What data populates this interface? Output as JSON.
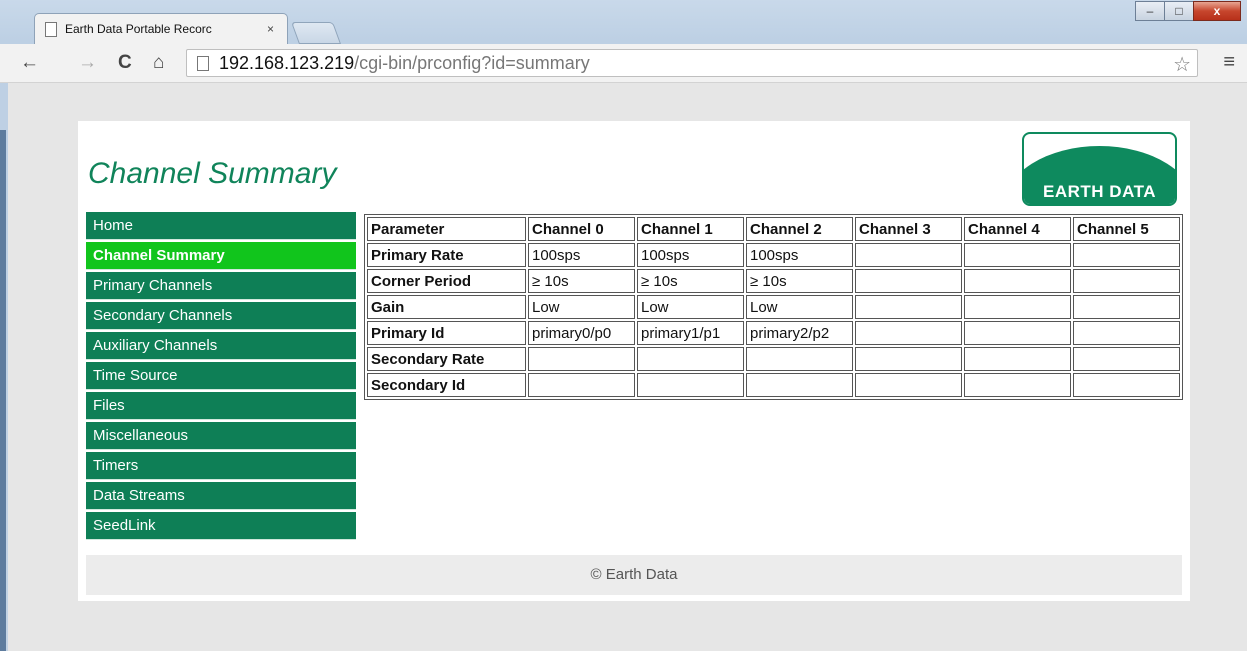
{
  "browser": {
    "tab_title": "Earth Data Portable Recorc",
    "tab_close": "×",
    "url_host": "192.168.123.219",
    "url_path": "/cgi-bin/prconfig?id=summary",
    "nav": {
      "back": "←",
      "forward": "→",
      "reload": "C",
      "home": "⌂"
    },
    "window_buttons": {
      "minimize": "–",
      "maximize": "□",
      "close": "x"
    }
  },
  "page": {
    "title": "Channel Summary",
    "logo_text": "EARTH DATA",
    "footer": "© Earth Data"
  },
  "sidebar": {
    "items": [
      {
        "label": "Home",
        "active": false
      },
      {
        "label": "Channel Summary",
        "active": true
      },
      {
        "label": "Primary Channels",
        "active": false
      },
      {
        "label": "Secondary Channels",
        "active": false
      },
      {
        "label": "Auxiliary Channels",
        "active": false
      },
      {
        "label": "Time Source",
        "active": false
      },
      {
        "label": "Files",
        "active": false
      },
      {
        "label": "Miscellaneous",
        "active": false
      },
      {
        "label": "Timers",
        "active": false
      },
      {
        "label": "Data Streams",
        "active": false
      },
      {
        "label": "SeedLink",
        "active": false
      }
    ]
  },
  "table": {
    "headers": [
      "Parameter",
      "Channel 0",
      "Channel 1",
      "Channel 2",
      "Channel 3",
      "Channel 4",
      "Channel 5"
    ],
    "rows": [
      [
        "Primary Rate",
        "100sps",
        "100sps",
        "100sps",
        "",
        "",
        ""
      ],
      [
        "Corner Period",
        "≥ 10s",
        "≥ 10s",
        "≥ 10s",
        "",
        "",
        ""
      ],
      [
        "Gain",
        "Low",
        "Low",
        "Low",
        "",
        "",
        ""
      ],
      [
        "Primary Id",
        "primary0/p0",
        "primary1/p1",
        "primary2/p2",
        "",
        "",
        ""
      ],
      [
        "Secondary Rate",
        "",
        "",
        "",
        "",
        "",
        ""
      ],
      [
        "Secondary Id",
        "",
        "",
        "",
        "",
        "",
        ""
      ]
    ]
  },
  "colors": {
    "nav_bg": "#0e7f56",
    "nav_active_bg": "#11c51c",
    "title_color": "#10845a"
  }
}
